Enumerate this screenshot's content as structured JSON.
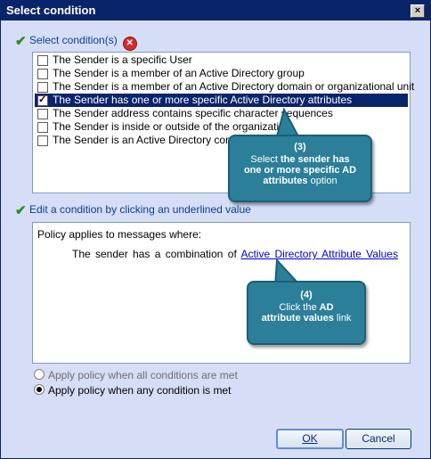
{
  "window": {
    "title": "Select condition",
    "close_label": "×"
  },
  "conditions": {
    "header": "Select condition(s)",
    "items": [
      {
        "label": "The Sender is a specific User",
        "checked": false
      },
      {
        "label": "The Sender is a member of an Active Directory group",
        "checked": false
      },
      {
        "label": "The Sender is a member of an Active Directory domain or organizational unit",
        "checked": false
      },
      {
        "label": "The Sender has one or more specific Active Directory attributes",
        "checked": true
      },
      {
        "label": "The Sender address contains specific character sequences",
        "checked": false
      },
      {
        "label": "The Sender is inside or outside of the organization",
        "checked": false
      },
      {
        "label": "The Sender is an Active Directory contact",
        "checked": false
      }
    ]
  },
  "edit": {
    "header": "Edit a condition by clicking an underlined value",
    "policy_intro": "Policy applies to messages where:",
    "policy_prefix": "The sender has a combination of",
    "policy_link": "Active Directory Attribute Values"
  },
  "callout3": {
    "num": "(3)",
    "line1a": "Select ",
    "line1b": "the sender has",
    "line2": "one or more specific AD",
    "line3a": "attributes",
    "line3b": " option"
  },
  "callout4": {
    "num": "(4)",
    "line1": "Click the ",
    "line1b": "AD",
    "line2a": "attribute values",
    "line2b": " link"
  },
  "radios": {
    "all": "Apply policy when all conditions are met",
    "any": "Apply policy when any condition is met"
  },
  "buttons": {
    "ok": "OK",
    "cancel": "Cancel"
  }
}
